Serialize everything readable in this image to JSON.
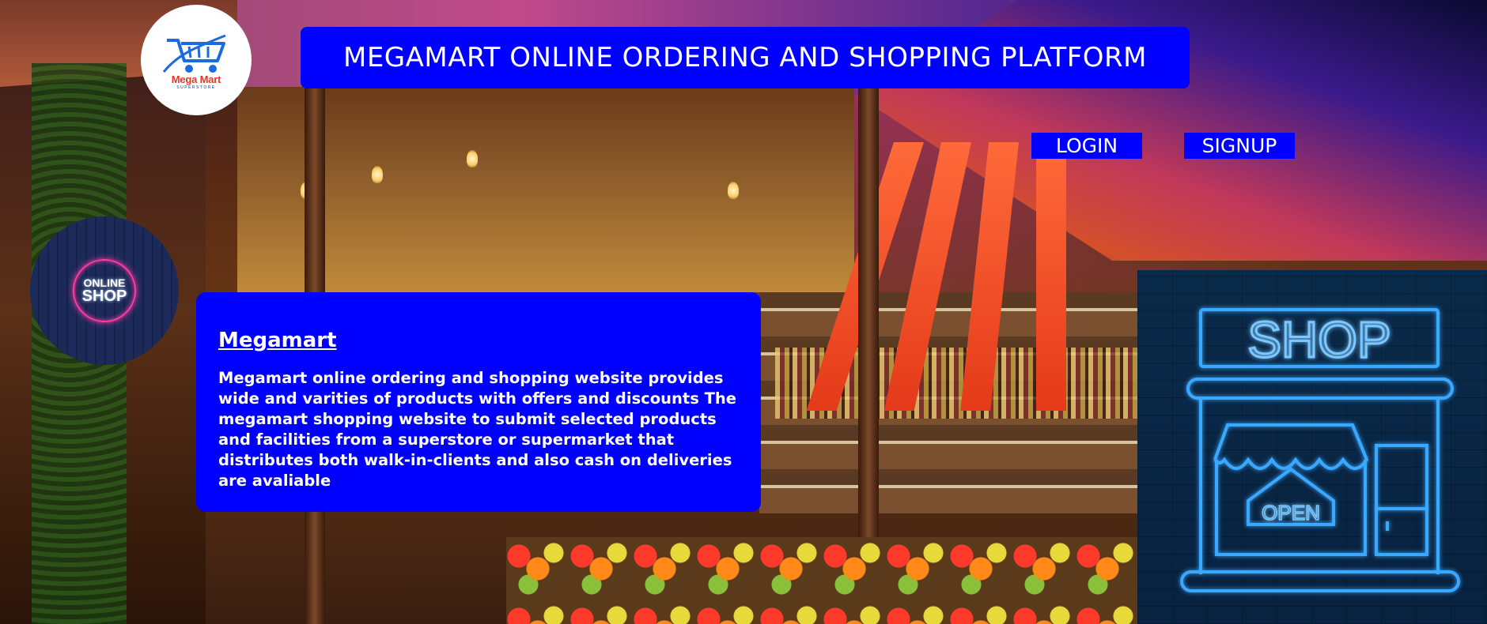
{
  "header": {
    "title": "MEGAMART ONLINE ORDERING AND SHOPPING PLATFORM"
  },
  "logo": {
    "name": "Mega Mart",
    "tagline": "SUPERSTORE",
    "icon": "shopping-cart-icon"
  },
  "nav": {
    "login_label": "LOGIN",
    "signup_label": "SIGNUP"
  },
  "badge": {
    "line1": "ONLINE",
    "line2": "SHOP"
  },
  "info": {
    "heading": "Megamart",
    "body": "Megamart online ordering and shopping website provides wide and varities of products with offers and discounts The megamart shopping website to submit selected products and facilities from a superstore or supermarket that distributes both walk-in-clients and also cash on deliveries are avaliable"
  },
  "shop_sign": {
    "sign_text": "SHOP",
    "door_sign": "OPEN"
  },
  "colors": {
    "primary_blue": "#0000ff",
    "text_white": "#ffffff",
    "neon_blue": "#3aa8ff",
    "neon_pink": "#ff3aa0",
    "logo_red": "#e0392b"
  }
}
